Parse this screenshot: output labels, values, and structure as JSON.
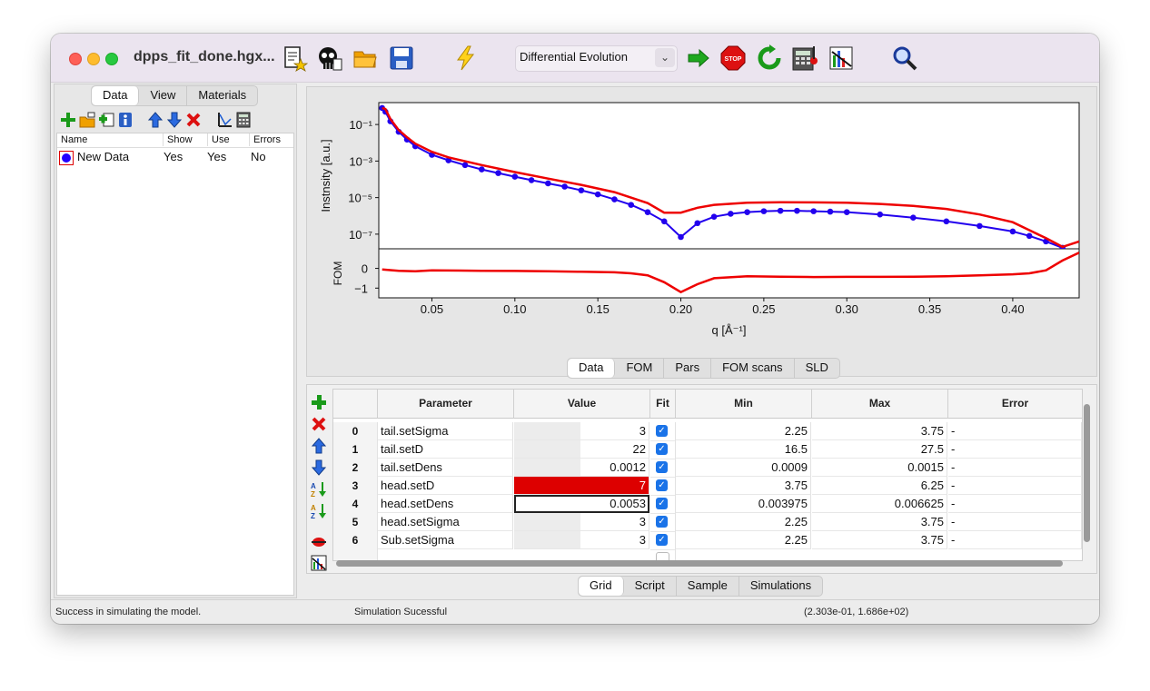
{
  "window": {
    "title": "dpps_fit_done.hgx..."
  },
  "toolbar": {
    "icons": [
      "new-model-icon",
      "skull-sim-icon",
      "open-folder-icon",
      "save-icon",
      "lightning-icon",
      "start-fit-icon",
      "stop-icon",
      "refresh-icon",
      "calculator-icon",
      "bar-chart-icon",
      "magnifier-icon"
    ],
    "algorithm": "Differential Evolution"
  },
  "left": {
    "tabs": [
      "Data",
      "View",
      "Materials"
    ],
    "active_tab": "Data",
    "columns": [
      "Name",
      "Show",
      "Use",
      "Errors"
    ],
    "rows": [
      {
        "name": "New Data",
        "show": "Yes",
        "use": "Yes",
        "errors": "No",
        "color": "#2200ff"
      }
    ]
  },
  "plot_tabs": [
    "Data",
    "FOM",
    "Pars",
    "FOM scans",
    "SLD"
  ],
  "plot_active_tab": "Data",
  "chart_data": {
    "type": "line",
    "xlabel": "q [Å⁻¹]",
    "top": {
      "ylabel": "Instnsity [a.u.]",
      "yscale": "log",
      "yticks": [
        "10⁻¹",
        "10⁻³",
        "10⁻⁵",
        "10⁻⁷"
      ],
      "series": [
        {
          "style": "markers",
          "color": "#2200ee",
          "x": [
            0.02,
            0.022,
            0.025,
            0.03,
            0.035,
            0.04,
            0.05,
            0.06,
            0.07,
            0.08,
            0.09,
            0.1,
            0.11,
            0.12,
            0.13,
            0.14,
            0.15,
            0.16,
            0.17,
            0.18,
            0.19,
            0.2,
            0.21,
            0.22,
            0.23,
            0.24,
            0.25,
            0.26,
            0.27,
            0.28,
            0.29,
            0.3,
            0.32,
            0.34,
            0.36,
            0.38,
            0.4,
            0.41,
            0.42,
            0.43
          ],
          "y": [
            0.8,
            0.5,
            0.15,
            0.04,
            0.015,
            0.0065,
            0.0022,
            0.0011,
            0.0006,
            0.00035,
            0.00022,
            0.00014,
            9e-05,
            6e-05,
            4e-05,
            2.5e-05,
            1.5e-05,
            8e-06,
            4e-06,
            1.6e-06,
            5e-07,
            7e-08,
            4e-07,
            9e-07,
            1.3e-06,
            1.6e-06,
            1.8e-06,
            1.9e-06,
            1.9e-06,
            1.8e-06,
            1.7e-06,
            1.6e-06,
            1.2e-06,
            8e-07,
            5e-07,
            2.8e-07,
            1.4e-07,
            8e-08,
            4e-08,
            1.8e-08
          ]
        },
        {
          "style": "line",
          "color": "#ee0000",
          "x": [
            0.02,
            0.022,
            0.025,
            0.03,
            0.035,
            0.04,
            0.05,
            0.06,
            0.08,
            0.1,
            0.12,
            0.14,
            0.16,
            0.18,
            0.19,
            0.2,
            0.21,
            0.22,
            0.24,
            0.26,
            0.28,
            0.3,
            0.32,
            0.34,
            0.36,
            0.38,
            0.4,
            0.42,
            0.43,
            0.44
          ],
          "y": [
            0.8,
            0.7,
            0.2,
            0.05,
            0.02,
            0.009,
            0.0032,
            0.0016,
            0.0006,
            0.00025,
            0.00011,
            5e-05,
            2e-05,
            5e-06,
            1.5e-06,
            1.5e-06,
            2.8e-06,
            4e-06,
            5.2e-06,
            5.6e-06,
            5.5e-06,
            5.2e-06,
            4.5e-06,
            3.5e-06,
            2.4e-06,
            1.2e-06,
            4.5e-07,
            6e-08,
            2e-08,
            4e-08
          ]
        }
      ]
    },
    "bottom": {
      "ylabel": "FOM",
      "yticks": [
        "0",
        "−1"
      ],
      "series": [
        {
          "style": "line",
          "color": "#ee0000",
          "x": [
            0.02,
            0.03,
            0.04,
            0.05,
            0.08,
            0.1,
            0.12,
            0.14,
            0.16,
            0.17,
            0.18,
            0.19,
            0.2,
            0.21,
            0.22,
            0.24,
            0.26,
            0.28,
            0.3,
            0.32,
            0.34,
            0.36,
            0.38,
            0.4,
            0.41,
            0.42,
            0.43,
            0.44
          ],
          "y": [
            -0.05,
            -0.12,
            -0.15,
            -0.1,
            -0.12,
            -0.13,
            -0.15,
            -0.17,
            -0.2,
            -0.25,
            -0.35,
            -0.7,
            -1.2,
            -0.8,
            -0.5,
            -0.4,
            -0.42,
            -0.44,
            -0.43,
            -0.43,
            -0.42,
            -0.4,
            -0.35,
            -0.3,
            -0.25,
            -0.1,
            0.4,
            0.8
          ]
        }
      ]
    },
    "xticks": [
      "0.05",
      "0.10",
      "0.15",
      "0.20",
      "0.25",
      "0.30",
      "0.35",
      "0.40"
    ],
    "xlim": [
      0.018,
      0.44
    ]
  },
  "grid": {
    "columns": [
      "Parameter",
      "Value",
      "Fit",
      "Min",
      "Max",
      "Error"
    ],
    "rows": [
      {
        "idx": "0",
        "parameter": "tail.setSigma",
        "value": "3",
        "fit": true,
        "min": "2.25",
        "max": "3.75",
        "error": "-"
      },
      {
        "idx": "1",
        "parameter": "tail.setD",
        "value": "22",
        "fit": true,
        "min": "16.5",
        "max": "27.5",
        "error": "-"
      },
      {
        "idx": "2",
        "parameter": "tail.setDens",
        "value": "0.0012",
        "fit": true,
        "min": "0.0009",
        "max": "0.0015",
        "error": "-"
      },
      {
        "idx": "3",
        "parameter": "head.setD",
        "value": "7",
        "fit": true,
        "min": "3.75",
        "max": "6.25",
        "error": "-",
        "highlight": "#dd0000"
      },
      {
        "idx": "4",
        "parameter": "head.setDens",
        "value": "0.0053",
        "fit": true,
        "min": "0.003975",
        "max": "0.006625",
        "error": "-",
        "selected": true
      },
      {
        "idx": "5",
        "parameter": "head.setSigma",
        "value": "3",
        "fit": true,
        "min": "2.25",
        "max": "3.75",
        "error": "-"
      },
      {
        "idx": "6",
        "parameter": "Sub.setSigma",
        "value": "3",
        "fit": true,
        "min": "2.25",
        "max": "3.75",
        "error": "-"
      }
    ]
  },
  "grid_tabs": [
    "Grid",
    "Script",
    "Sample",
    "Simulations"
  ],
  "grid_active_tab": "Grid",
  "status": {
    "left": "Success in simulating the model.",
    "middle": "Simulation Sucessful",
    "right": "(2.303e-01, 1.686e+02)"
  }
}
